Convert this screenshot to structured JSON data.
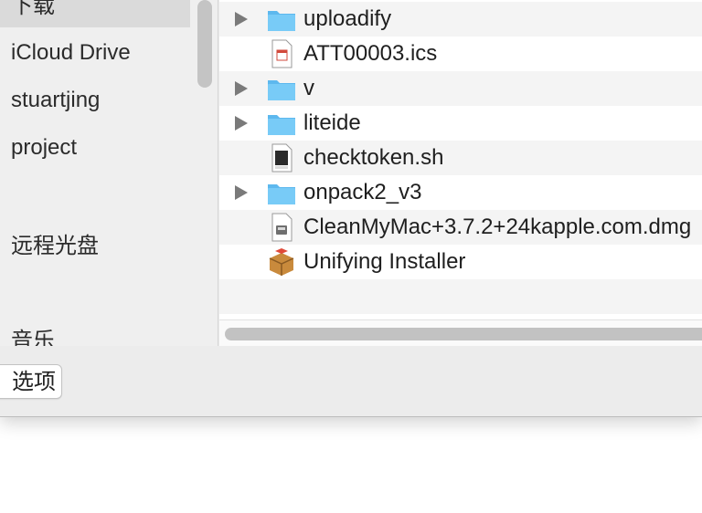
{
  "sidebar": {
    "items": [
      {
        "label": "下载"
      },
      {
        "label": "iCloud Drive"
      },
      {
        "label": "stuartjing"
      },
      {
        "label": "project"
      },
      {
        "label": "远程光盘"
      },
      {
        "label": "音乐"
      }
    ]
  },
  "files": [
    {
      "name": "uploadify",
      "icon": "folder-icon",
      "expandable": true
    },
    {
      "name": "ATT00003.ics",
      "icon": "calendar-file-icon",
      "expandable": false
    },
    {
      "name": "v",
      "icon": "folder-icon",
      "expandable": true
    },
    {
      "name": "liteide",
      "icon": "folder-icon",
      "expandable": true
    },
    {
      "name": "checktoken.sh",
      "icon": "shell-script-icon",
      "expandable": false
    },
    {
      "name": "onpack2_v3",
      "icon": "folder-icon",
      "expandable": true
    },
    {
      "name": "CleanMyMac+3.7.2+24kapple.com.dmg",
      "icon": "disk-image-icon",
      "expandable": false
    },
    {
      "name": "Unifying Installer",
      "icon": "installer-package-icon",
      "expandable": false
    }
  ],
  "bottom_bar": {
    "options_label": "选项"
  },
  "colors": {
    "folder": "#6cc4f5",
    "selection": "#dadada"
  }
}
